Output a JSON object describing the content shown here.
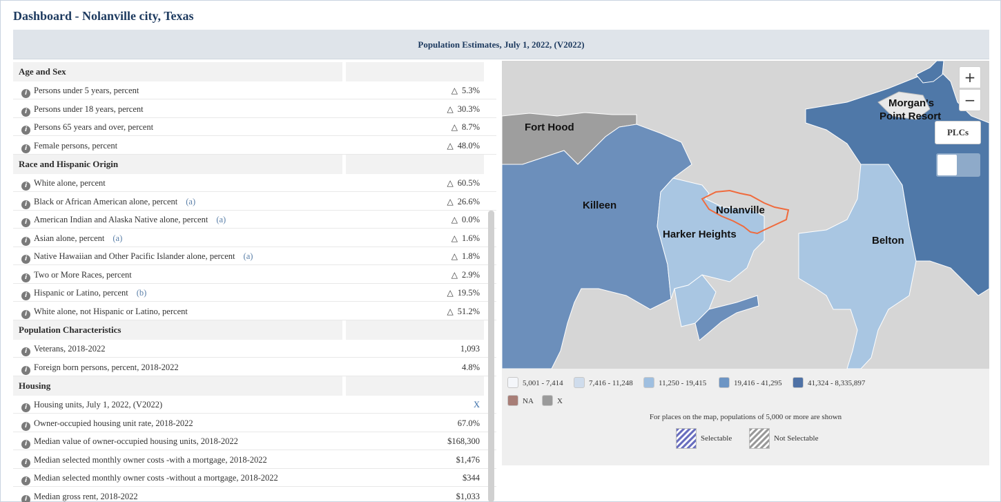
{
  "page": {
    "title": "Dashboard - Nolanville city, Texas"
  },
  "header": {
    "title": "Population Estimates, July 1, 2022, (V2022)"
  },
  "table": {
    "sections": [
      {
        "title": "Age and Sex",
        "rows": [
          {
            "label": "Persons under 5 years, percent",
            "note": "",
            "flag": true,
            "value": "5.3%"
          },
          {
            "label": "Persons under 18 years, percent",
            "note": "",
            "flag": true,
            "value": "30.3%"
          },
          {
            "label": "Persons 65 years and over, percent",
            "note": "",
            "flag": true,
            "value": "8.7%"
          },
          {
            "label": "Female persons, percent",
            "note": "",
            "flag": true,
            "value": "48.0%"
          }
        ]
      },
      {
        "title": "Race and Hispanic Origin",
        "rows": [
          {
            "label": "White alone, percent",
            "note": "",
            "flag": true,
            "value": "60.5%"
          },
          {
            "label": "Black or African American alone, percent",
            "note": "(a)",
            "flag": true,
            "value": "26.6%"
          },
          {
            "label": "American Indian and Alaska Native alone, percent",
            "note": "(a)",
            "flag": true,
            "value": "0.0%"
          },
          {
            "label": "Asian alone, percent",
            "note": "(a)",
            "flag": true,
            "value": "1.6%"
          },
          {
            "label": "Native Hawaiian and Other Pacific Islander alone, percent",
            "note": "(a)",
            "flag": true,
            "value": "1.8%"
          },
          {
            "label": "Two or More Races, percent",
            "note": "",
            "flag": true,
            "value": "2.9%"
          },
          {
            "label": "Hispanic or Latino, percent",
            "note": "(b)",
            "flag": true,
            "value": "19.5%"
          },
          {
            "label": "White alone, not Hispanic or Latino, percent",
            "note": "",
            "flag": true,
            "value": "51.2%"
          }
        ]
      },
      {
        "title": "Population Characteristics",
        "rows": [
          {
            "label": "Veterans, 2018-2022",
            "note": "",
            "flag": false,
            "value": "1,093"
          },
          {
            "label": "Foreign born persons, percent, 2018-2022",
            "note": "",
            "flag": false,
            "value": "4.8%"
          }
        ]
      },
      {
        "title": "Housing",
        "rows": [
          {
            "label": "Housing units, July 1, 2022, (V2022)",
            "note": "",
            "flag": false,
            "value": "X",
            "link": true
          },
          {
            "label": "Owner-occupied housing unit rate, 2018-2022",
            "note": "",
            "flag": false,
            "value": "67.0%"
          },
          {
            "label": "Median value of owner-occupied housing units, 2018-2022",
            "note": "",
            "flag": false,
            "value": "$168,300"
          },
          {
            "label": "Median selected monthly owner costs -with a mortgage, 2018-2022",
            "note": "",
            "flag": false,
            "value": "$1,476"
          },
          {
            "label": "Median selected monthly owner costs -without a mortgage, 2018-2022",
            "note": "",
            "flag": false,
            "value": "$344"
          },
          {
            "label": "Median gross rent, 2018-2022",
            "note": "",
            "flag": false,
            "value": "$1,033"
          }
        ]
      }
    ]
  },
  "map": {
    "labels": {
      "fort_hood": "Fort Hood",
      "killeen": "Killeen",
      "nolanville": "Nolanville",
      "harker_heights": "Harker Heights",
      "belton": "Belton",
      "morgans_point_1": "Morgan's",
      "morgans_point_2": "Point Resort"
    },
    "controls": {
      "zoom_in": "+",
      "zoom_out": "−",
      "plcs": "PLCs"
    },
    "colors": {
      "background": "#d6d6d6",
      "darkest": "#4f78a8",
      "dark": "#6c8fbb",
      "medium": "#8ab0d6",
      "light": "#a9c6e2",
      "gray": "#9e9e9e",
      "highlight": "#f06a3c"
    }
  },
  "legend": {
    "items": [
      {
        "label": "5,001 - 7,414",
        "color": "#f4f6fa"
      },
      {
        "label": "7,416 - 11,248",
        "color": "#cfdcec"
      },
      {
        "label": "11,250 - 19,415",
        "color": "#9fbfe0"
      },
      {
        "label": "19,416 - 41,295",
        "color": "#6d95c4"
      },
      {
        "label": "41,324 - 8,335,897",
        "color": "#4f72a6"
      }
    ],
    "extra": [
      {
        "label": "NA",
        "color": "#a87e77"
      },
      {
        "label": "X",
        "color": "#9a9a9a"
      }
    ],
    "note": "For places on the map, populations of 5,000 or more are shown",
    "selectable": "Selectable",
    "not_selectable": "Not Selectable"
  }
}
